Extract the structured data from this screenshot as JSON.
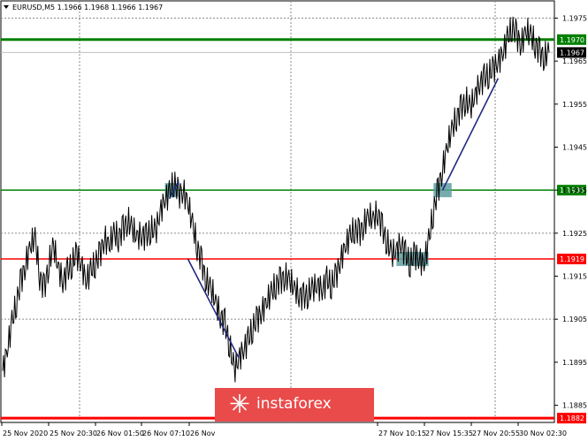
{
  "chart_data": {
    "type": "line",
    "title": "EURUSD,M5  1.1966 1.1968 1.1966 1.1967",
    "x_ticks": [
      "25 Nov 2020",
      "25 Nov 20:30",
      "26 Nov 01:50",
      "26 Nov 07:10",
      "26 Nov",
      "27 Nov 10:15",
      "27 Nov 15:35",
      "27 Nov 20:55",
      "30 Nov 02:30"
    ],
    "y_ticks": [
      1.1975,
      1.1965,
      1.1955,
      1.1945,
      1.1935,
      1.1925,
      1.1915,
      1.1905,
      1.1895,
      1.1885
    ],
    "ylim": [
      1.1881,
      1.1979
    ],
    "grid": true,
    "series": [
      {
        "values": [
          1.1893,
          1.1898,
          1.1904,
          1.1909,
          1.1914,
          1.1918,
          1.1922,
          1.1924,
          1.1915,
          1.1912,
          1.1918,
          1.1922,
          1.1917,
          1.1914,
          1.1916,
          1.1918,
          1.192,
          1.1918,
          1.1914,
          1.1916,
          1.1918,
          1.192,
          1.1924,
          1.1922,
          1.1925,
          1.1924,
          1.1926,
          1.1928,
          1.1926,
          1.1924,
          1.1925,
          1.1924,
          1.1926,
          1.1925,
          1.193,
          1.1933,
          1.1934,
          1.1937,
          1.1934,
          1.1935,
          1.1932,
          1.1927,
          1.1922,
          1.1918,
          1.1914,
          1.1912,
          1.1909,
          1.1906,
          1.1904,
          1.1899,
          1.1893,
          1.1896,
          1.1898,
          1.19,
          1.1903,
          1.1905,
          1.1907,
          1.1909,
          1.1911,
          1.1913,
          1.1914,
          1.1915,
          1.1914,
          1.1912,
          1.1911,
          1.191,
          1.1911,
          1.1912,
          1.1913,
          1.1912,
          1.1914,
          1.1913,
          1.1915,
          1.1919,
          1.1922,
          1.1924,
          1.1926,
          1.1925,
          1.1927,
          1.1929,
          1.1928,
          1.193,
          1.1926,
          1.1923,
          1.192,
          1.1921,
          1.1923,
          1.192,
          1.1918,
          1.192,
          1.1919,
          1.1918,
          1.1923,
          1.193,
          1.1935,
          1.194,
          1.1945,
          1.1949,
          1.1952,
          1.1954,
          1.1956,
          1.1954,
          1.1957,
          1.196,
          1.1961,
          1.1962,
          1.1963,
          1.1965,
          1.1967,
          1.197,
          1.1973,
          1.1971,
          1.1969,
          1.1972,
          1.1971,
          1.1969,
          1.1967,
          1.1966,
          1.1967
        ]
      }
    ],
    "levels": [
      {
        "label": "1.1970",
        "value": 1.197,
        "color": "#008000"
      },
      {
        "label": "1.1935",
        "value": 1.1935,
        "color": "#008000"
      },
      {
        "label": "1.1919",
        "value": 1.1919,
        "color": "#ff0000"
      },
      {
        "label": "1.1882",
        "value": 1.1882,
        "color": "#ff0000"
      }
    ],
    "current_price": {
      "label": "1.1967",
      "value": 1.1967
    },
    "markers": [
      {
        "from_index": 36,
        "to_index": 37,
        "value": 1.1935
      },
      {
        "from_index": 86,
        "to_index": 91,
        "value": 1.1919
      },
      {
        "from_index": 94,
        "to_index": 96,
        "value": 1.1935
      }
    ],
    "trendlines": [
      {
        "from_index": 36,
        "from_value": 1.1933,
        "to_index": 38,
        "to_value": 1.1937
      },
      {
        "from_index": 40,
        "from_value": 1.1919,
        "to_index": 51,
        "to_value": 1.1896
      },
      {
        "from_index": 95,
        "from_value": 1.1935,
        "to_index": 107,
        "to_value": 1.1961
      }
    ]
  },
  "watermark": {
    "brand": "instaforex"
  },
  "colors": {
    "price_line": "#000000",
    "grid": "#8a8a8a",
    "marker": "#5f9ea0",
    "trendline": "#1f2a80",
    "watermark_bg": "#e94b4b",
    "current_badge_bg": "#000000"
  }
}
